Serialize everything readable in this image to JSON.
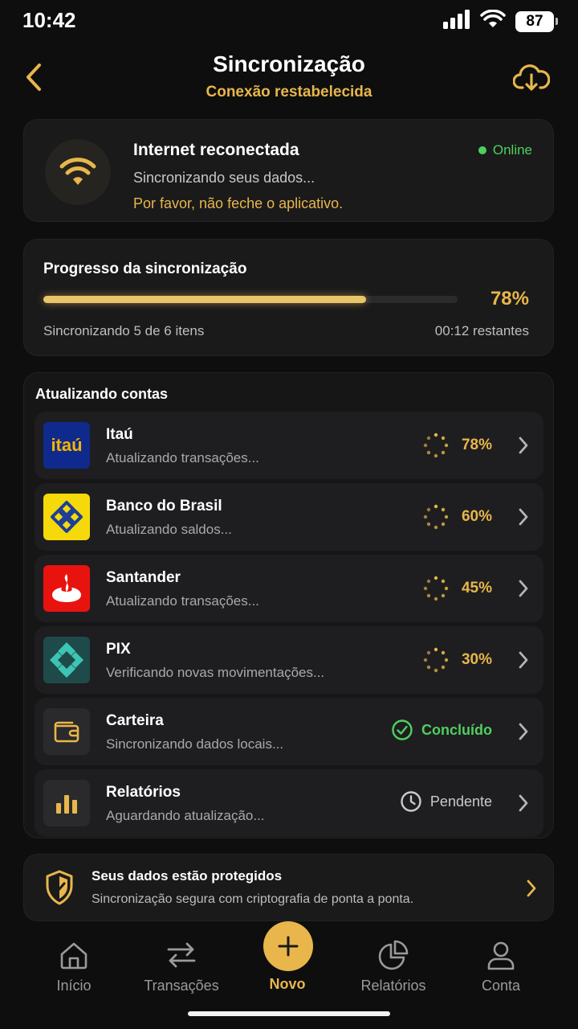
{
  "status_bar": {
    "time": "10:42",
    "battery": "87"
  },
  "header": {
    "title": "Sincronização",
    "subtitle": "Conexão restabelecida"
  },
  "connection": {
    "title": "Internet reconectada",
    "description": "Sincronizando seus dados...",
    "warning": "Por favor, não feche o aplicativo.",
    "status": "Online"
  },
  "progress": {
    "title": "Progresso da sincronização",
    "percent_label": "78%",
    "percent_value": 78,
    "items_label": "Sincronizando 5 de 6 itens",
    "remaining_label": "00:12 restantes"
  },
  "accounts": {
    "title": "Atualizando contas",
    "items": [
      {
        "name": "Itaú",
        "description": "Atualizando transações...",
        "status": "78%",
        "logo_text": "itaú"
      },
      {
        "name": "Banco do Brasil",
        "description": "Atualizando saldos...",
        "status": "60%"
      },
      {
        "name": "Santander",
        "description": "Atualizando transações...",
        "status": "45%"
      },
      {
        "name": "PIX",
        "description": "Verificando novas movimentações...",
        "status": "30%"
      },
      {
        "name": "Carteira",
        "description": "Sincronizando dados locais...",
        "status": "Concluído"
      },
      {
        "name": "Relatórios",
        "description": "Aguardando atualização...",
        "status": "Pendente"
      }
    ]
  },
  "security": {
    "title": "Seus dados estão protegidos",
    "description": "Sincronização segura com criptografia de ponta a ponta."
  },
  "nav": {
    "home": "Início",
    "transactions": "Transações",
    "new": "Novo",
    "reports": "Relatórios",
    "account": "Conta"
  },
  "colors": {
    "accent": "#e8b64a",
    "success": "#4fcf5e",
    "background": "#0e0e0f",
    "card": "#1a1a1b"
  }
}
